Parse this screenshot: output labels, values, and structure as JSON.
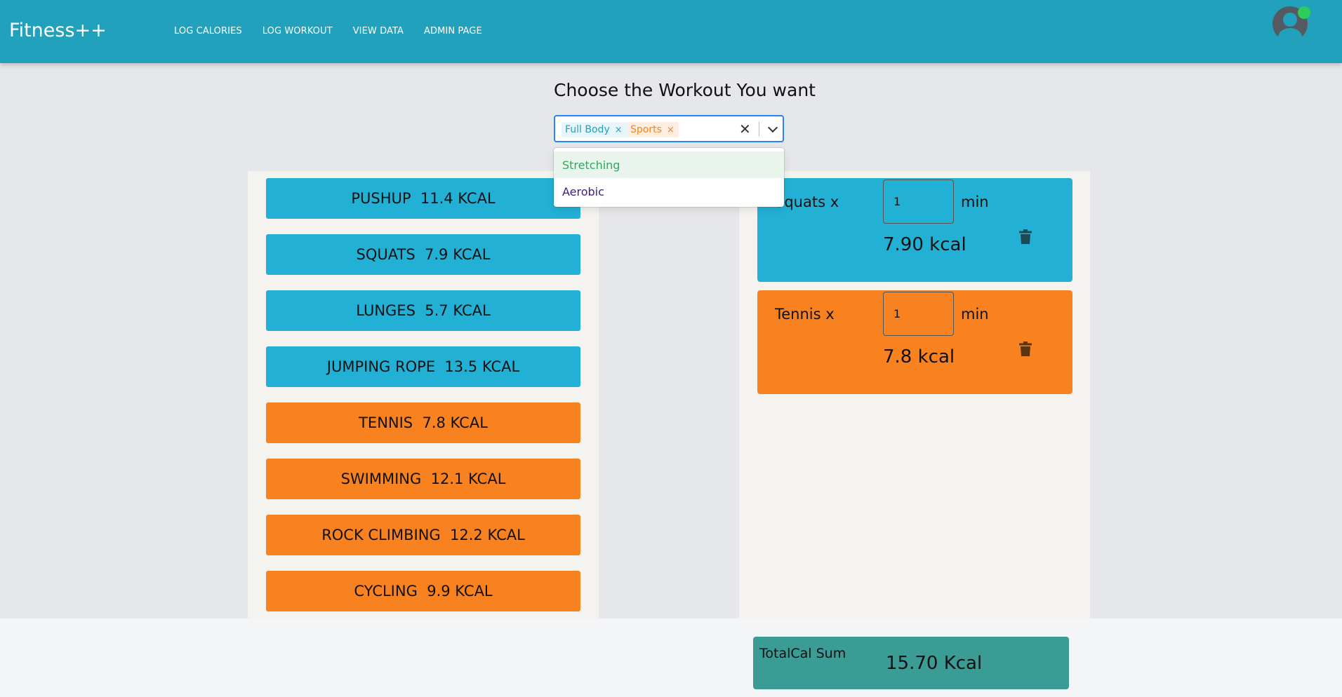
{
  "app": {
    "brand": "Fitness++"
  },
  "nav": {
    "items": [
      "LOG CALORIES",
      "LOG WORKOUT",
      "VIEW DATA",
      "ADMIN PAGE"
    ]
  },
  "header": {
    "title": "Choose the Workout You want"
  },
  "filter": {
    "selected": [
      {
        "label": "Full Body",
        "remove": "×"
      },
      {
        "label": "Sports",
        "remove": "×"
      }
    ],
    "clear_glyph": "✕",
    "options": [
      "Stretching",
      "Aerobic"
    ]
  },
  "workouts": [
    {
      "label": "PUSHUP  11.4 KCAL",
      "category": "Full Body"
    },
    {
      "label": "SQUATS  7.9 KCAL",
      "category": "Full Body"
    },
    {
      "label": "LUNGES  5.7 KCAL",
      "category": "Full Body"
    },
    {
      "label": "JUMPING ROPE  13.5 KCAL",
      "category": "Full Body"
    },
    {
      "label": "TENNIS  7.8 KCAL",
      "category": "Sports"
    },
    {
      "label": "SWIMMING  12.1 KCAL",
      "category": "Sports"
    },
    {
      "label": "ROCK CLIMBING  12.2 KCAL",
      "category": "Sports"
    },
    {
      "label": "CYCLING  9.9 KCAL",
      "category": "Sports"
    }
  ],
  "selected_workouts": [
    {
      "name": "Squats x",
      "minutes": "1",
      "unit": "min",
      "kcal": "7.90 kcal"
    },
    {
      "name": "Tennis x",
      "minutes": "1",
      "unit": "min",
      "kcal": "7.8 kcal"
    }
  ],
  "total": {
    "label": "TotalCal Sum",
    "value": "15.70 Kcal"
  },
  "colors": {
    "navbar": "#21a1bb",
    "full_body": "#23b0d5",
    "sports": "#f8821f",
    "total": "#3a9c94",
    "online": "#2ecc5a"
  }
}
